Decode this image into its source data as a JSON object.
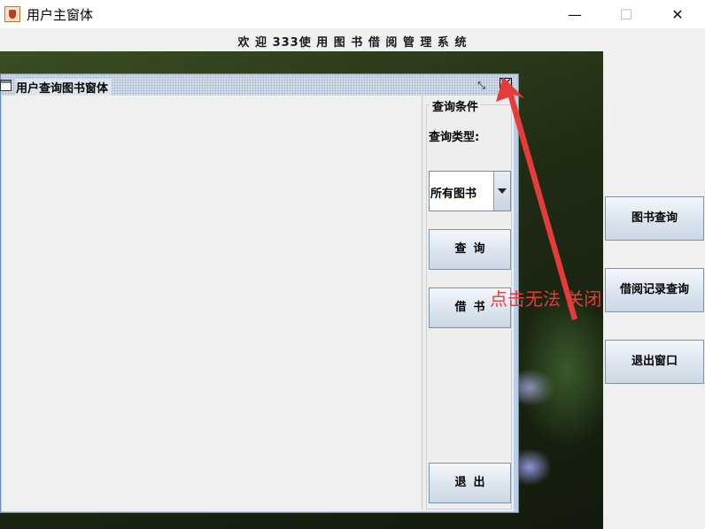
{
  "window": {
    "title": "用户主窗体",
    "minimize": "—",
    "maximize": "☐",
    "close": "✕"
  },
  "welcome": "欢 迎 333使 用 图 书 借 阅 管 理 系 统",
  "internal_frame": {
    "title": "用户查询图书窗体",
    "query_panel": {
      "legend": "查询条件",
      "type_label": "查询类型:",
      "type_value": "所有图书",
      "search_label": "查询",
      "borrow_label": "借书",
      "exit_label": "退出"
    }
  },
  "side_buttons": {
    "book_query": "图书查询",
    "borrow_records": "借阅记录查询",
    "exit_window": "退出窗口"
  },
  "annotation": {
    "text": "点击无法 关闭",
    "color": "#e43b3b"
  }
}
